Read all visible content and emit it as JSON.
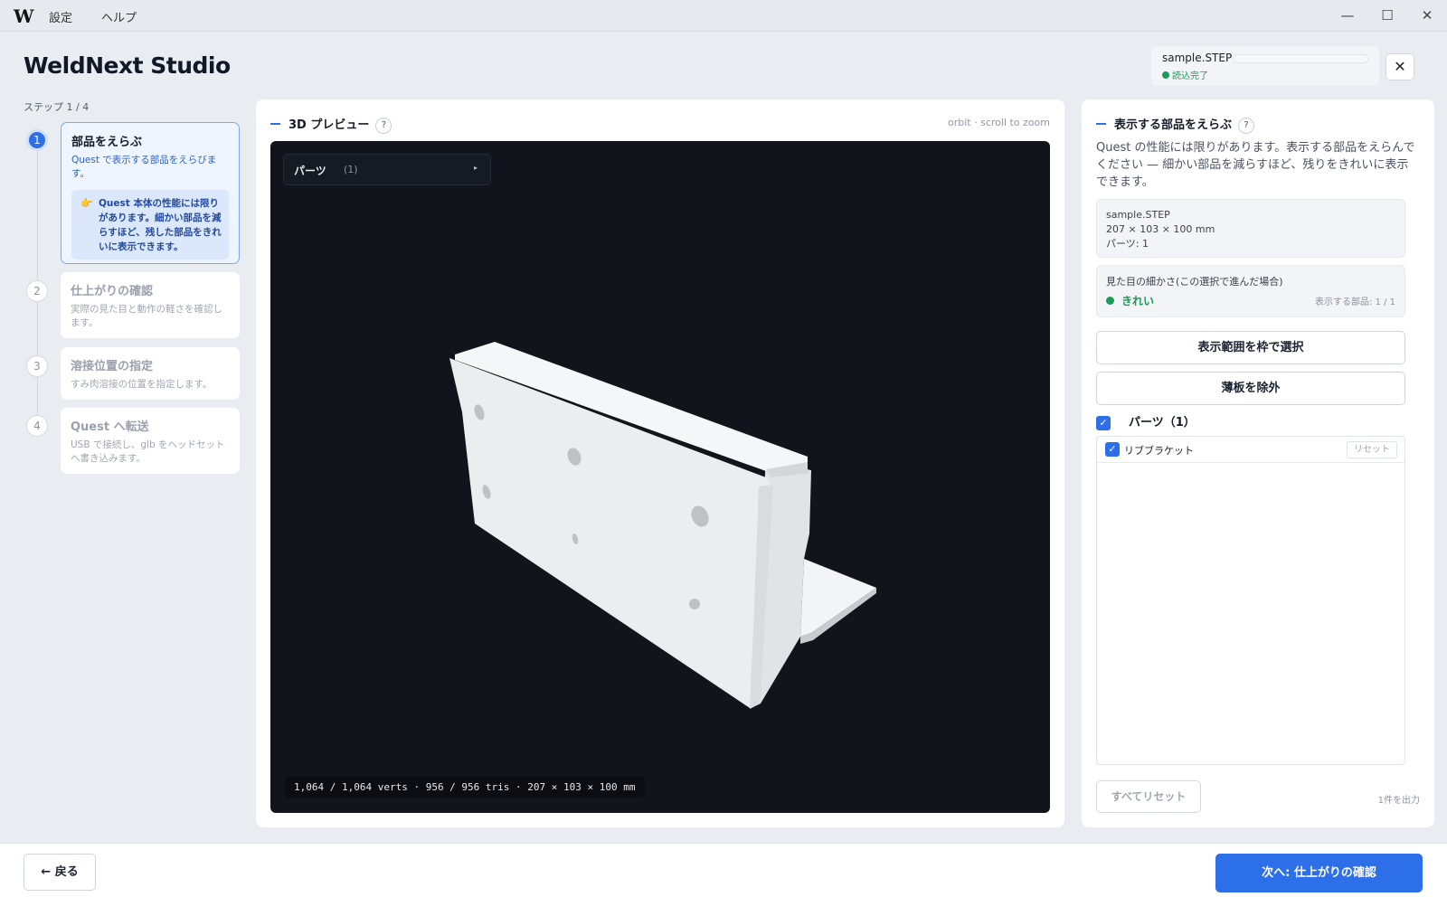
{
  "window": {
    "logo": "W",
    "menu": [
      "設定",
      "ヘルプ"
    ],
    "minimize": "—",
    "maximize": "☐",
    "close": "✕"
  },
  "header": {
    "title": "WeldNext Studio",
    "file_name": "sample.STEP",
    "file_status": "読込完了",
    "close_label": "✕"
  },
  "stepper": {
    "count_label": "ステップ 1 / 4",
    "steps": [
      {
        "num": "1",
        "title": "部品をえらぶ",
        "desc": "Quest で表示する部品をえらびます。",
        "hint": "Quest 本体の性能には限りがあります。細かい部品を減らすほど、残した部品をきれいに表示できます。",
        "hint_icon": "👉"
      },
      {
        "num": "2",
        "title": "仕上がりの確認",
        "desc": "実際の見た目と動作の軽さを確認します。"
      },
      {
        "num": "3",
        "title": "溶接位置の指定",
        "desc": "すみ肉溶接の位置を指定します。"
      },
      {
        "num": "4",
        "title": "Quest へ転送",
        "desc": "USB で接続し、glb をヘッドセットへ書き込みます。"
      }
    ]
  },
  "preview": {
    "title": "3D プレビュー",
    "help": "?",
    "orbit_hint": "orbit · scroll to zoom",
    "parts_label": "パーツ",
    "parts_count": "(1)",
    "parts_arrow": "▸",
    "stats": "1,064 / 1,064 verts · 956 / 956 tris · 207 × 103 × 100 mm"
  },
  "side": {
    "title": "表示する部品をえらぶ",
    "help": "?",
    "desc": "Quest の性能には限りがあります。表示する部品をえらんでください — 細かい部品を減らすほど、残りをきれいに表示できます。",
    "file_info": [
      "sample.STEP",
      "207 × 103 × 100 mm",
      "パーツ: 1"
    ],
    "quality_label": "見た目の細かさ(この選択で進んだ場合)",
    "quality_value": "きれい",
    "quality_count": "表示する部品: 1 / 1",
    "btn_box_select": "表示範囲を枠で選択",
    "btn_exclude_thin": "薄板を除外",
    "group_label": "パーツ（1）",
    "check_mark": "✓",
    "parts": [
      {
        "name": "リブブラケット",
        "reset": "リセット"
      }
    ],
    "reset_all": "すべてリセット",
    "output_count": "1件を出力"
  },
  "footer": {
    "back": "← 戻る",
    "next": "次へ: 仕上がりの確認"
  },
  "colors": {
    "accent": "#2c6fe8",
    "success": "#1d9a55",
    "viewport_bg": "#11141b"
  }
}
